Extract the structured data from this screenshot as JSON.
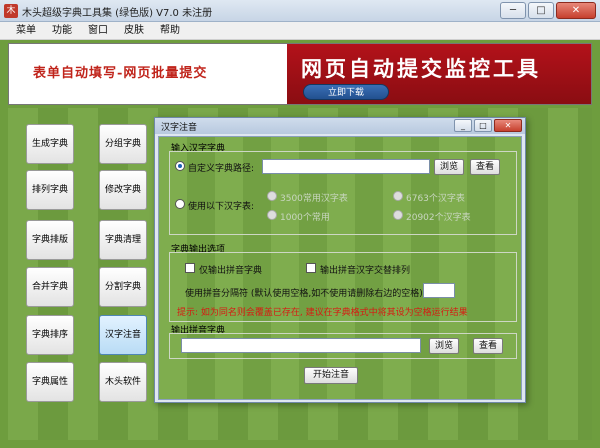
{
  "window": {
    "title": "木头超级字典工具集 (绿色版) V7.0   未注册",
    "min_label": "─",
    "max_label": "□",
    "close_label": "✕"
  },
  "menu": [
    "菜单",
    "功能",
    "窗口",
    "皮肤",
    "帮助"
  ],
  "banner": {
    "left_text": "表单自动填写-网页批量提交",
    "title": "网页自动提交监控工具",
    "button_label": "立即下载"
  },
  "left_buttons": [
    "生成字典",
    "分组字典",
    "排列字典",
    "修改字典",
    "字典排版",
    "字典清理",
    "合并字典",
    "分割字典",
    "字典排序",
    "汉字注音",
    "字典属性",
    "木头软件"
  ],
  "dialog": {
    "title": "汉字注音",
    "min_label": "_",
    "max_label": "□",
    "close_label": "✕",
    "input_group": {
      "label": "输入汉字字典",
      "custom_label": "自定义字典路径:",
      "browse_label": "浏览",
      "view_label": "查看",
      "builtin_label": "使用以下汉字表:",
      "opt1": "3500常用汉字表",
      "opt2": "6763个汉字表",
      "opt3": "1000个常用",
      "opt4": "20902个汉字表"
    },
    "output_group": {
      "label": "字典输出选项",
      "only_pinyin_label": "仅输出拼音字典",
      "output_arrange_label": "输出拼音汉字交替排列",
      "separator_label": "使用拼音分隔符 (默认使用空格,如不使用请删除右边的空格):",
      "warning": "提示: 如为同名则会覆盖已存在, 建议在字典格式中将其设为空格运行结果"
    },
    "output_file": {
      "label": "输出拼音字典",
      "browse_label": "浏览",
      "view_label": "查看"
    },
    "start_label": "开始注音"
  }
}
